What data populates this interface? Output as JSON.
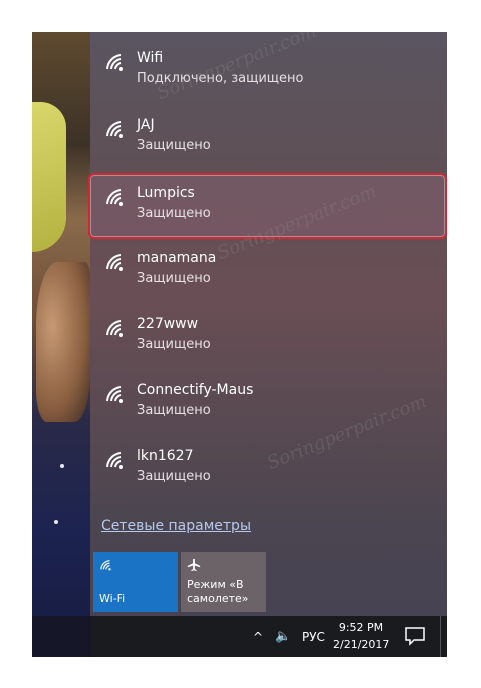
{
  "networks": [
    {
      "name": "Wifi",
      "status": "Подключено, защищено"
    },
    {
      "name": "JAJ",
      "status": "Защищено"
    },
    {
      "name": "Lumpics",
      "status": "Защищено"
    },
    {
      "name": "manamana",
      "status": "Защищено"
    },
    {
      "name": "227www",
      "status": "Защищено"
    },
    {
      "name": "Connectify-Maus",
      "status": "Защищено"
    },
    {
      "name": "lkn1627",
      "status": "Защищено"
    }
  ],
  "settings_link": "Сетевые параметры",
  "tiles": {
    "wifi_label": "Wi-Fi",
    "airplane_line1": "Режим «В",
    "airplane_line2": "самолете»"
  },
  "taskbar": {
    "chevron": "^",
    "volume": "🔈",
    "language": "РУС",
    "time": "9:52 PM",
    "date": "2/21/2017"
  },
  "watermark": "Soringperpair.com",
  "colors": {
    "accent": "#1a73c4",
    "highlight_border": "#d32632"
  }
}
